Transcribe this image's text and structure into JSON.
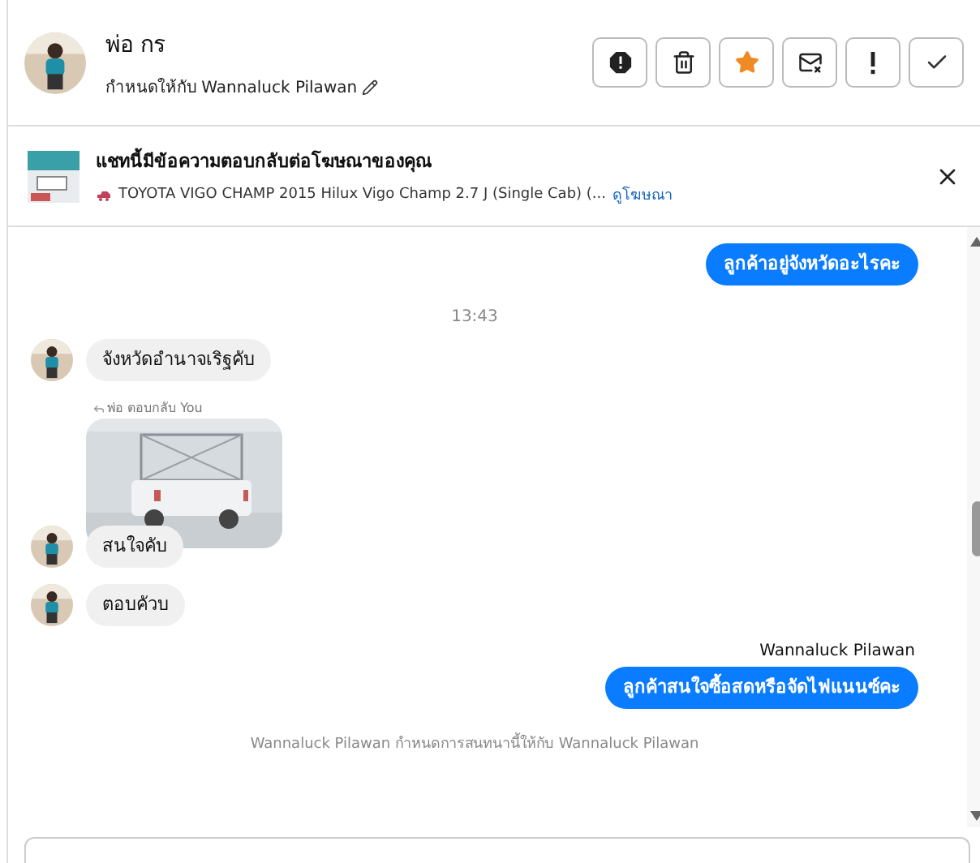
{
  "header": {
    "name": "พ่อ กร",
    "assigned": "กำหนดให้กับ Wannaluck Pilawan"
  },
  "actions": [
    {
      "kind": "alert"
    },
    {
      "kind": "trash"
    },
    {
      "kind": "star",
      "on": true
    },
    {
      "kind": "mail"
    },
    {
      "kind": "exclaim"
    },
    {
      "kind": "check"
    }
  ],
  "ad_banner": {
    "title": "แชทนี้มีข้อความตอบกลับต่อโฆษณาของคุณ",
    "ad": "TOYOTA VIGO CHAMP 2015 Hilux Vigo Champ 2.7 J (Single Cab) (...",
    "link": "ดูโฆษณา"
  },
  "messages": [
    {
      "kind": "outgoing",
      "text": "ลูกค้าอยู่จังหวัดอะไรคะ"
    },
    {
      "kind": "time",
      "text": "13:43"
    },
    {
      "kind": "incoming",
      "text": "จังหวัดอำนาจเริฐคับ"
    },
    {
      "kind": "reply",
      "text": "พ่อ ตอบกลับ You"
    },
    {
      "kind": "image_reply",
      "text": "สนใจคับ"
    },
    {
      "kind": "incoming",
      "text": "ตอบคัวบ"
    },
    {
      "kind": "outgoing",
      "sender": "Wannaluck Pilawan",
      "text": "ลูกค้าสนใจซื้อสดหรือจัดไฟแนนซ์คะ"
    },
    {
      "kind": "system",
      "text": "Wannaluck Pilawan กำหนดการสนทนานี้ให้กับ Wannaluck Pilawan"
    }
  ]
}
